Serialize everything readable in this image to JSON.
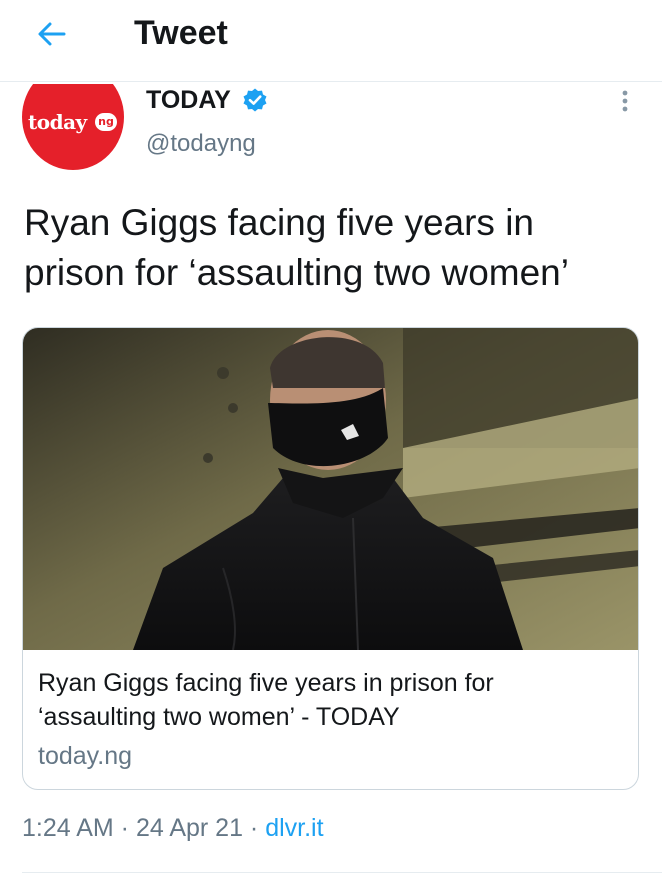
{
  "header": {
    "title": "Tweet",
    "back_icon": "arrow-left-icon"
  },
  "author": {
    "avatar_logo_text": "today",
    "avatar_logo_badge": "ng",
    "display_name": "TODAY",
    "verified_icon": "verified-badge-icon",
    "handle": "@todayng",
    "more_icon": "more-vertical-icon"
  },
  "tweet": {
    "text": "Ryan Giggs facing five years in prison for ‘assaulting two women’"
  },
  "card": {
    "image_icon": "article-photo",
    "title": "Ryan Giggs facing five years in prison for ‘assaulting two women’ - TODAY",
    "domain": "today.ng"
  },
  "meta": {
    "time": "1:24 AM",
    "separator": " · ",
    "date": "24 Apr 21",
    "source": "dlvr.it"
  },
  "colors": {
    "accent": "#1da1f2",
    "brand_red": "#e5202a",
    "secondary_text": "#657786"
  }
}
